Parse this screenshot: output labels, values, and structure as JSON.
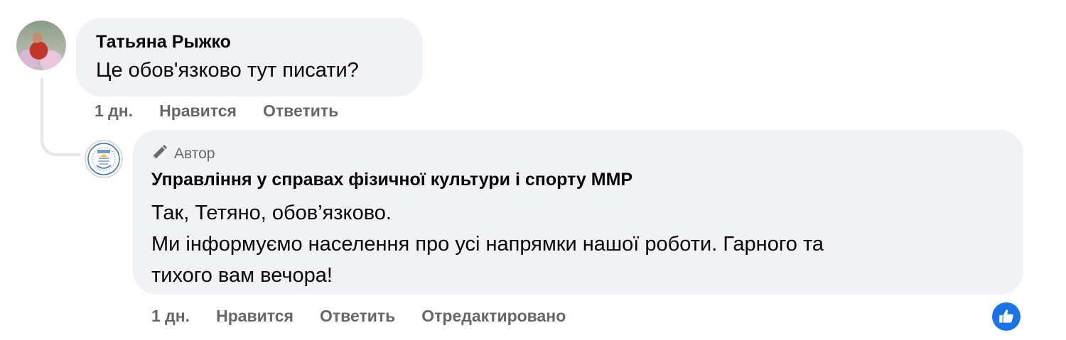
{
  "thread": {
    "comment": {
      "author": "Татьяна Рыжко",
      "text": "Це обов'язково тут писати?",
      "time": "1 дн.",
      "like_label": "Нравится",
      "reply_label": "Ответить"
    },
    "reply": {
      "badge": "Автор",
      "author": "Управління у справах фізичної культури і спорту ММР",
      "lines": [
        "Так, Тетяно, обов’язково.",
        "Ми інформуємо населення про усі напрямки нашої роботи. Гарного та",
        "тихого вам вечора!"
      ],
      "time": "1 дн.",
      "like_label": "Нравится",
      "reply_label": "Ответить",
      "edited_label": "Отредактировано",
      "reaction_icon": "thumbs-up-icon"
    }
  },
  "colors": {
    "bubble": "#f0f2f5",
    "text": "#050505",
    "secondary": "#65676b",
    "reaction": "#1b74e4"
  }
}
